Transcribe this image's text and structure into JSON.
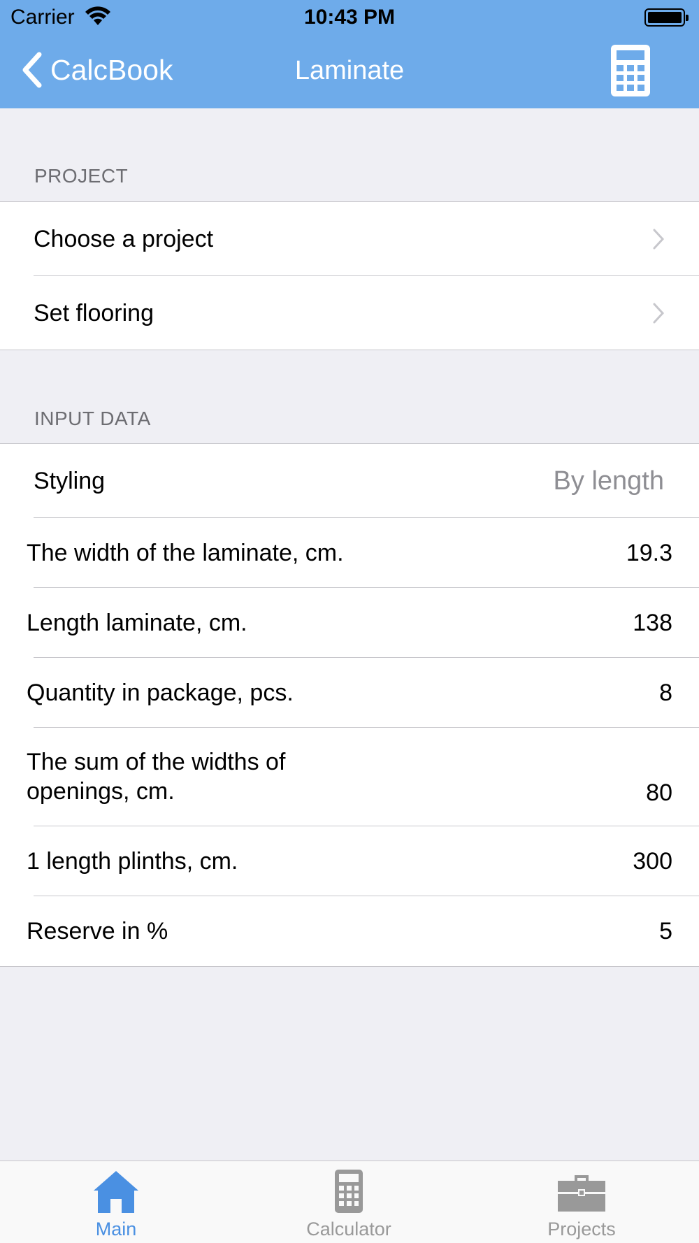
{
  "status_bar": {
    "carrier": "Carrier",
    "time": "10:43 PM"
  },
  "nav": {
    "back_label": "CalcBook",
    "title": "Laminate"
  },
  "sections": {
    "project": {
      "header": "PROJECT",
      "rows": [
        "Choose a project",
        "Set flooring"
      ]
    },
    "input": {
      "header": "INPUT DATA",
      "styling_label": "Styling",
      "styling_value": "By length",
      "fields": [
        {
          "label": "The width of the laminate, cm.",
          "value": "19.3"
        },
        {
          "label": "Length laminate, cm.",
          "value": "138"
        },
        {
          "label": "Quantity in package, pcs.",
          "value": "8"
        },
        {
          "label": "The sum of the widths of openings, cm.",
          "value": "80"
        },
        {
          "label": "1 length plinths, cm.",
          "value": "300"
        },
        {
          "label": "Reserve in %",
          "value": "5"
        }
      ]
    }
  },
  "tabbar": {
    "tabs": [
      {
        "label": "Main",
        "icon": "home-icon",
        "active": true
      },
      {
        "label": "Calculator",
        "icon": "calculator-icon",
        "active": false
      },
      {
        "label": "Projects",
        "icon": "briefcase-icon",
        "active": false
      }
    ]
  },
  "colors": {
    "accent": "#6eabea",
    "active_tab": "#4a90e2",
    "inactive_tab": "#999999",
    "background": "#efeff4"
  }
}
